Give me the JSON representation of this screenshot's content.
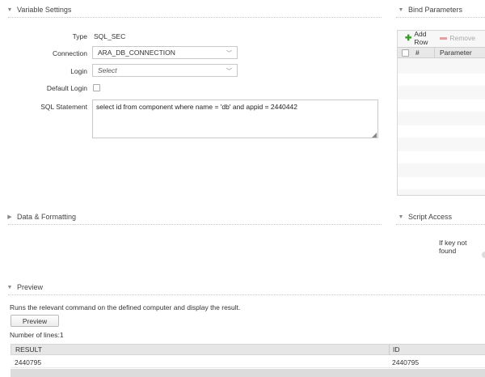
{
  "variable_settings": {
    "title": "Variable Settings",
    "type_label": "Type",
    "type_value": "SQL_SEC",
    "connection_label": "Connection",
    "connection_value": "ARA_DB_CONNECTION",
    "login_label": "Login",
    "login_placeholder": "Select",
    "default_login_label": "Default Login",
    "default_login_checked": false,
    "sql_label": "SQL Statement",
    "sql_value": "select id from component where name = 'db' and appid = 2440442"
  },
  "bind_parameters": {
    "title": "Bind Parameters",
    "add_row_label": "Add Row",
    "remove_label": "Remove",
    "col_hash": "#",
    "col_parameter": "Parameter"
  },
  "data_formatting": {
    "title": "Data & Formatting"
  },
  "script_access": {
    "title": "Script Access",
    "if_key_not_found_label": "If key not found"
  },
  "preview": {
    "title": "Preview",
    "description": "Runs the relevant command on the defined computer and display the result.",
    "button_label": "Preview",
    "lines_label": "Number of lines:1",
    "columns": [
      "RESULT",
      "ID"
    ],
    "rows": [
      [
        "2440795",
        "2440795"
      ]
    ]
  },
  "colors": {
    "accent_plus": "#3a9a2a",
    "header_bg": "#e6e6e6"
  },
  "icons": [
    "collapse-triangle-icon",
    "expand-triangle-icon",
    "chevron-down-icon",
    "plus-icon",
    "minus-icon",
    "resize-grip-icon"
  ]
}
